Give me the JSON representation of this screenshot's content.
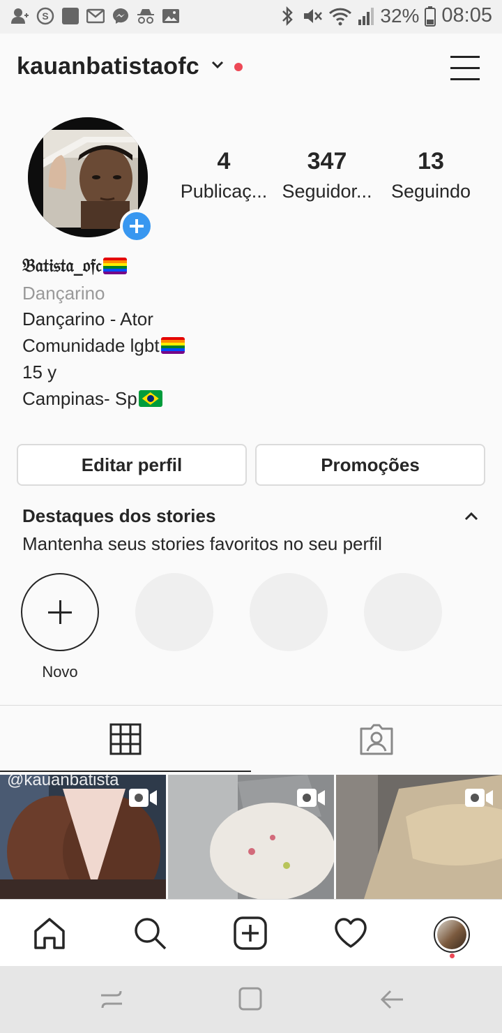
{
  "status_bar": {
    "battery": "32%",
    "time": "08:05"
  },
  "header": {
    "username": "kauanbatistaofc"
  },
  "profile": {
    "stats": [
      {
        "value": "4",
        "label": "Publicaç..."
      },
      {
        "value": "347",
        "label": "Seguidor..."
      },
      {
        "value": "13",
        "label": "Seguindo"
      }
    ],
    "display_name": "𝔅𝔞𝔱𝔦𝔰𝔱𝔞_𝔬𝔣𝔠",
    "category": "Dançarino",
    "bio_lines": [
      "Dançarino - Ator",
      "Comunidade lgbt",
      "15 y",
      "Campinas- Sp"
    ]
  },
  "buttons": {
    "edit_profile": "Editar perfil",
    "promotions": "Promoções"
  },
  "highlights": {
    "title": "Destaques dos stories",
    "subtitle": "Mantenha seus stories favoritos no seu perfil",
    "new_label": "Novo"
  },
  "grid": {
    "watermark": "@kauanbatista"
  },
  "colors": {
    "accent_blue": "#3897f0",
    "notification_red": "#ed4956",
    "border": "#dbdbdb"
  }
}
